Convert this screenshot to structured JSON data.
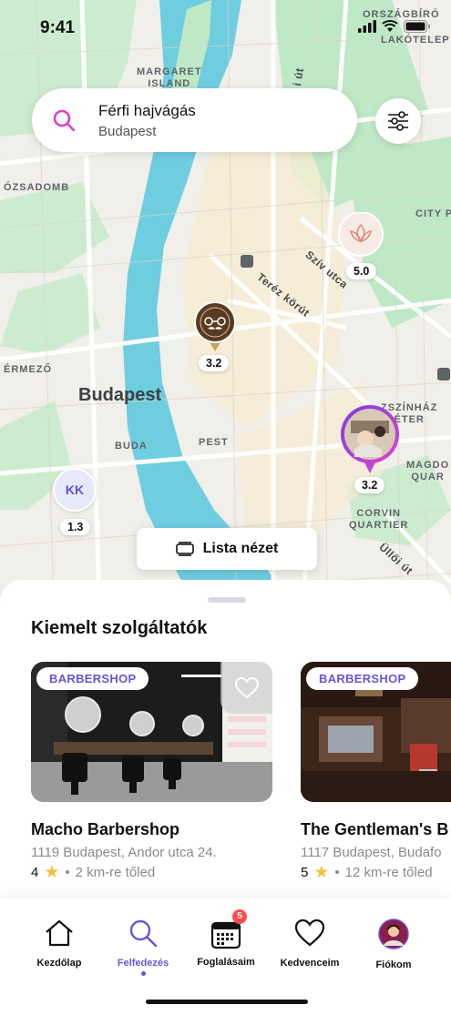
{
  "status_bar": {
    "time": "9:41"
  },
  "map": {
    "labels": {
      "margaret_island": "MARGARET\nISLAND",
      "orszagbiro": "ORSZÁGBÍRÓ",
      "lakotelep": "LAKÓTELEP",
      "ozsadomb": "ÓZSADOMB",
      "city": "CITY P",
      "ermezo": "ÉRMEZŐ",
      "budapest": "Budapest",
      "buda": "BUDA",
      "pest": "PEST",
      "szinhaz": "ZSZÍNHÁZ\nÉTER",
      "magdo": "MAGDO\nQUAR",
      "corvin": "CORVIN\nQUARTIER",
      "szent_ut": "i út",
      "teréz": "Teréz körút",
      "sziv": "Szív utca",
      "ulloi": "Üllői út"
    },
    "pins": [
      {
        "kind": "lotus",
        "rating": "5.0"
      },
      {
        "kind": "barber-logo",
        "rating": "3.2"
      },
      {
        "kind": "photo",
        "rating": "3.2"
      },
      {
        "kind": "initials",
        "initials": "KK",
        "rating": "1.3"
      }
    ]
  },
  "search": {
    "query": "Férfi hajvágás",
    "location": "Budapest"
  },
  "list_view_button": "Lista nézet",
  "sheet": {
    "title": "Kiemelt szolgáltatók",
    "cards": [
      {
        "tag": "BARBERSHOP",
        "name": "Macho Barbershop",
        "address": "1119 Budapest, Andor utca 24.",
        "rating": "4",
        "distance": "2 km-re tőled",
        "favorite": false
      },
      {
        "tag": "BARBERSHOP",
        "name": "The Gentleman's B",
        "address": "1117 Budapest, Budafo",
        "rating": "5",
        "distance": "12 km-re tőled"
      }
    ]
  },
  "tabbar": {
    "tabs": [
      {
        "label": "Kezdőlap",
        "icon": "home-icon"
      },
      {
        "label": "Felfedezés",
        "icon": "search-icon",
        "active": true
      },
      {
        "label": "Foglalásaim",
        "icon": "calendar-icon",
        "badge": "5"
      },
      {
        "label": "Kedvenceim",
        "icon": "heart-icon"
      },
      {
        "label": "Fiókom",
        "icon": "avatar"
      }
    ]
  },
  "colors": {
    "accent": "#6a54d8",
    "search_icon": "#e040c8",
    "river": "#6fcde0",
    "park": "#bfe8c6",
    "badge": "#ff4d4f"
  }
}
